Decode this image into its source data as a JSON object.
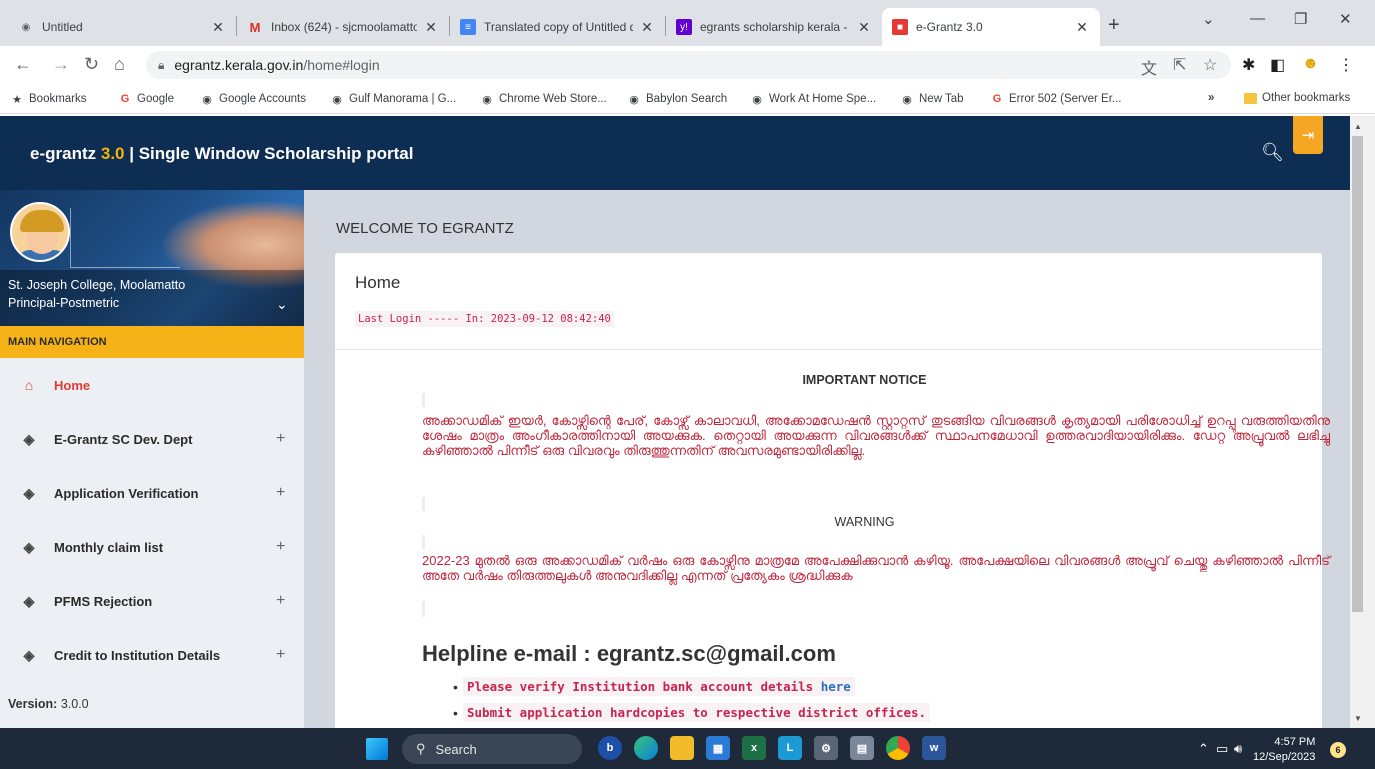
{
  "browser": {
    "tabs": [
      {
        "title": "Untitled",
        "favicon": "globe-icon"
      },
      {
        "title": "Inbox (624) - sjcmoolamatton",
        "favicon": "gmail-icon"
      },
      {
        "title": "Translated copy of Untitled d",
        "favicon": "docs-icon"
      },
      {
        "title": "egrants scholarship kerala - Y",
        "favicon": "yahoo-icon"
      },
      {
        "title": "e-Grantz 3.0",
        "favicon": "egrantz-icon",
        "active": true
      }
    ],
    "url_host": "egrantz.kerala.gov.in",
    "url_path": "/home#login",
    "bookmarks": [
      {
        "label": "Bookmarks",
        "icon": "star-icon"
      },
      {
        "label": "Google",
        "icon": "google-icon"
      },
      {
        "label": "Google Accounts",
        "icon": "globe-icon"
      },
      {
        "label": "Gulf Manorama | G...",
        "icon": "globe-icon"
      },
      {
        "label": "Chrome Web Store...",
        "icon": "globe-icon"
      },
      {
        "label": "Babylon Search",
        "icon": "globe-icon"
      },
      {
        "label": "Work At Home Spe...",
        "icon": "globe-icon"
      },
      {
        "label": "New Tab",
        "icon": "globe-icon"
      },
      {
        "label": "Error 502 (Server Er...",
        "icon": "google-icon"
      }
    ],
    "more_bookmarks": "»",
    "other_bookmarks": "Other bookmarks"
  },
  "header": {
    "brand_name": "e-grantz",
    "brand_version": "3.0",
    "brand_suffix": "| Single Window Scholarship portal"
  },
  "sidebar": {
    "college": "St. Joseph College, Moolamatto",
    "role": "Principal-Postmetric",
    "nav_heading": "MAIN NAVIGATION",
    "items": [
      {
        "label": "Home",
        "icon": "home-icon",
        "expandable": false
      },
      {
        "label": "E-Grantz SC Dev. Dept",
        "icon": "layers-icon",
        "expandable": true
      },
      {
        "label": "Application Verification",
        "icon": "layers-icon",
        "expandable": true
      },
      {
        "label": "Monthly claim list",
        "icon": "layers-icon",
        "expandable": true
      },
      {
        "label": "PFMS Rejection",
        "icon": "layers-icon",
        "expandable": true
      },
      {
        "label": "Credit to Institution Details",
        "icon": "layers-icon",
        "expandable": true
      }
    ],
    "expand_symbol": "+",
    "version_label": "Version:",
    "version_value": "3.0.0"
  },
  "main": {
    "welcome": "WELCOME TO EGRANTZ",
    "card_title": "Home",
    "last_login": "Last Login ----- In: 2023-09-12 08:42:40",
    "notice_title": "IMPORTANT NOTICE",
    "notice_text": "അക്കാഡമിക് ഇയർ, കോഴ്സിന്റെ പേര്, കോഴ്സ് കാലാവധി, അക്കോമഡേഷൻ സ്റ്റാറ്റസ് തുടങ്ങിയ വിവരങ്ങൾ കൃത്യമായി പരിശോധിച്ച് ഉറപ്പു വരുത്തിയതിനു ശേഷം മാത്രം അംഗീകാരത്തിനായി അയക്കുക. തെറ്റായി അയക്കുന്ന വിവരങ്ങൾക്ക് സ്ഥാപനമേധാവി ഉത്തരവാദിയായിരിക്കും. ഡേറ്റ അപ്രൂവൽ ലഭിച്ചു കഴിഞ്ഞാൽ പിന്നീട് ഒരു വിവരവും തിരുത്തുന്നതിന് അവസരമുണ്ടായിരിക്കില്ല.",
    "warning_title": "WARNING",
    "warning_text": "2022-23 മുതൽ ഒരു അക്കാഡമിക് വർഷം ഒരു കോഴ്സിനു മാത്രമേ അപേക്ഷിക്കുവാൻ കഴിയൂ. അപേക്ഷയിലെ വിവരങ്ങൾ അപ്രൂവ് ചെയ്തു കഴിഞ്ഞാൽ പിന്നീട് അതേ വർഷം തിരുത്തലുകൾ അനുവദിക്കില്ല എന്നത് പ്രത്യേകം ശ്രദ്ധിക്കുക",
    "helpline": "Helpline e-mail : egrantz.sc@gmail.com",
    "bullet1_text": "Please verify Institution bank account details",
    "bullet1_link": "here",
    "bullet2_text": "Submit application hardcopies to respective district offices."
  },
  "taskbar": {
    "search_label": "Search",
    "time": "4:57 PM",
    "date": "12/Sep/2023",
    "notification_count": "6"
  },
  "colors": {
    "header_bg": "#0e2d53",
    "accent_yellow": "#f5b317",
    "notice_red": "#c0263c",
    "code_pink": "#c7254e"
  }
}
